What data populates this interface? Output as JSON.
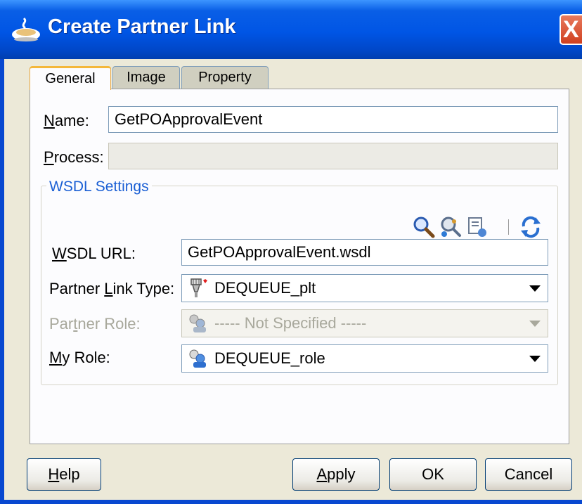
{
  "window": {
    "title": "Create Partner Link",
    "close_label": "X"
  },
  "tabs": [
    {
      "label": "General",
      "selected": true
    },
    {
      "label": "Image",
      "selected": false
    },
    {
      "label": "Property",
      "selected": false
    }
  ],
  "general": {
    "name_label_mnemonic": "N",
    "name_label_rest": "ame:",
    "name_value": "GetPOApprovalEvent",
    "process_label_mnemonic": "P",
    "process_label_rest": "rocess:",
    "process_value": ""
  },
  "wsdl": {
    "legend": "WSDL Settings",
    "toolbar_icons": [
      "search-icon",
      "browse-services-icon",
      "service-explorer-icon",
      "refresh-icon"
    ],
    "url_label_mnemonic": "W",
    "url_label_rest": "SDL URL:",
    "url_value": "GetPOApprovalEvent.wsdl",
    "plt_label_pre": "Partner ",
    "plt_label_mnemonic": "L",
    "plt_label_rest": "ink Type:",
    "plt_value": "DEQUEUE_plt",
    "partner_role_label_pre": "Par",
    "partner_role_label_mnemonic": "t",
    "partner_role_label_rest": "ner Role:",
    "partner_role_value": "----- Not Specified -----",
    "my_role_label_mnemonic": "M",
    "my_role_label_rest": "y Role:",
    "my_role_value": "DEQUEUE_role"
  },
  "buttons": {
    "help_mnemonic": "H",
    "help_rest": "elp",
    "apply_mnemonic": "A",
    "apply_rest": "pply",
    "ok": "OK",
    "cancel": "Cancel"
  },
  "colors": {
    "titlebar": "#0055e5",
    "dialog_bg": "#ece9d8",
    "legend": "#1a5fd4",
    "close_button": "#d0401f"
  }
}
